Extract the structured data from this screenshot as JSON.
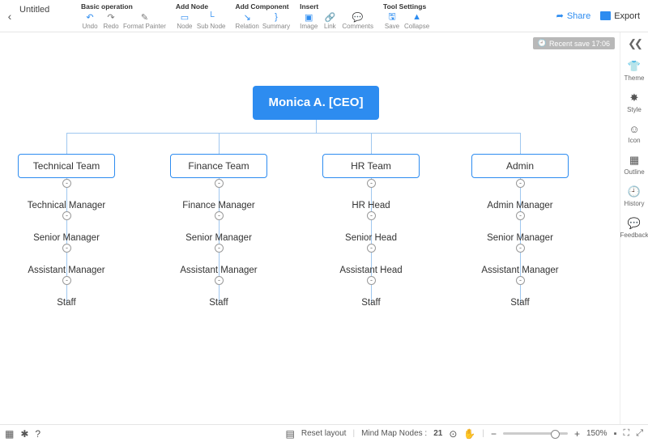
{
  "header": {
    "doc_title": "Untitled",
    "share_label": "Share",
    "export_label": "Export"
  },
  "toolbars": [
    {
      "title": "Basic operation",
      "items": [
        {
          "name": "undo",
          "label": "Undo",
          "icon": "↶"
        },
        {
          "name": "redo",
          "label": "Redo",
          "icon": "↷"
        },
        {
          "name": "format",
          "label": "Format Painter",
          "icon": "✎"
        }
      ]
    },
    {
      "title": "Add Node",
      "items": [
        {
          "name": "node",
          "label": "Node",
          "icon": "▭"
        },
        {
          "name": "subnode",
          "label": "Sub Node",
          "icon": "└"
        }
      ]
    },
    {
      "title": "Add Component",
      "items": [
        {
          "name": "relation",
          "label": "Relation",
          "icon": "↘"
        },
        {
          "name": "summary",
          "label": "Summary",
          "icon": "}"
        }
      ]
    },
    {
      "title": "Insert",
      "items": [
        {
          "name": "image",
          "label": "Image",
          "icon": "▣"
        },
        {
          "name": "link",
          "label": "Link",
          "icon": "🔗"
        },
        {
          "name": "comments",
          "label": "Comments",
          "icon": "💬"
        }
      ]
    },
    {
      "title": "Tool Settings",
      "items": [
        {
          "name": "save",
          "label": "Save",
          "icon": "🖫"
        },
        {
          "name": "collapse",
          "label": "Collapse",
          "icon": "▲"
        }
      ]
    }
  ],
  "rail": [
    {
      "name": "theme",
      "label": "Theme",
      "icon": "👕"
    },
    {
      "name": "style",
      "label": "Style",
      "icon": "✸"
    },
    {
      "name": "icon",
      "label": "Icon",
      "icon": "☺"
    },
    {
      "name": "outline",
      "label": "Outline",
      "icon": "▦"
    },
    {
      "name": "history",
      "label": "History",
      "icon": "🕘"
    },
    {
      "name": "feedback",
      "label": "Feedback",
      "icon": "💬"
    }
  ],
  "save_badge": "Recent save 17:06",
  "chart_data": {
    "type": "tree",
    "root": "Monica A. [CEO]",
    "branches": [
      {
        "name": "Technical Team",
        "children": [
          "Technical Manager",
          "Senior Manager",
          "Assistant Manager",
          "Staff"
        ]
      },
      {
        "name": "Finance Team",
        "children": [
          "Finance Manager",
          "Senior Manager",
          "Assistant Manager",
          "Staff"
        ]
      },
      {
        "name": "HR Team",
        "children": [
          "HR Head",
          "Senior Head",
          "Assistant Head",
          "Staff"
        ]
      },
      {
        "name": "Admin",
        "children": [
          "Admin Manager",
          "Senior Manager",
          "Assistant Manager",
          "Staff"
        ]
      }
    ]
  },
  "statusbar": {
    "reset_layout": "Reset layout",
    "nodes_label": "Mind Map Nodes :",
    "nodes_count": "21",
    "zoom_label": "150%"
  }
}
